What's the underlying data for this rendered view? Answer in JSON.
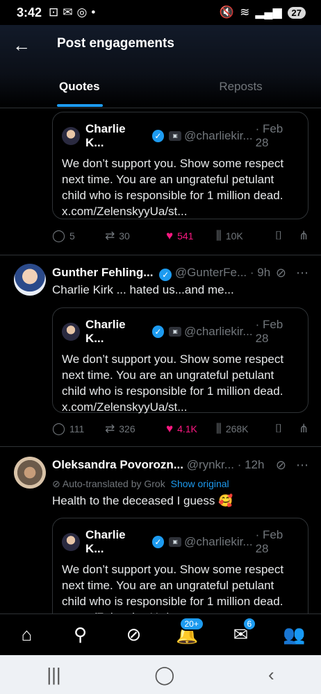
{
  "status_bar": {
    "time": "3:42",
    "dot": "•",
    "battery": "27"
  },
  "header": {
    "title": "Post engagements"
  },
  "tabs": [
    {
      "label": "Quotes"
    },
    {
      "label": "Reposts"
    }
  ],
  "quoted_post": {
    "name": "Charlie K...",
    "handle": "@charliekir...",
    "date": "· Feb 28",
    "text": "We don’t support you. Show some respect next time. You are an ungrateful petulant child who is responsible for 1 million dead. x.com/ZelenskyyUa/st..."
  },
  "posts": [
    {
      "actions": {
        "replies": "5",
        "reposts": "30",
        "likes": "541",
        "views": "10K"
      }
    },
    {
      "name": "Gunther Fehling...",
      "handle": "@GunterFe...",
      "time": "· 9h",
      "text": "Charlie Kirk ... hated us...and me...",
      "actions": {
        "replies": "111",
        "reposts": "326",
        "likes": "4.1K",
        "views": "268K"
      }
    },
    {
      "name": "Oleksandra Povorozn...",
      "handle": "@rynkr...",
      "time": "· 12h",
      "translated_label": "Auto-translated by Grok",
      "show_original": "Show original",
      "text": "Health to the deceased I guess 🥰"
    }
  ],
  "bottom_nav": {
    "notifications_badge": "20+",
    "messages_badge": "6"
  }
}
